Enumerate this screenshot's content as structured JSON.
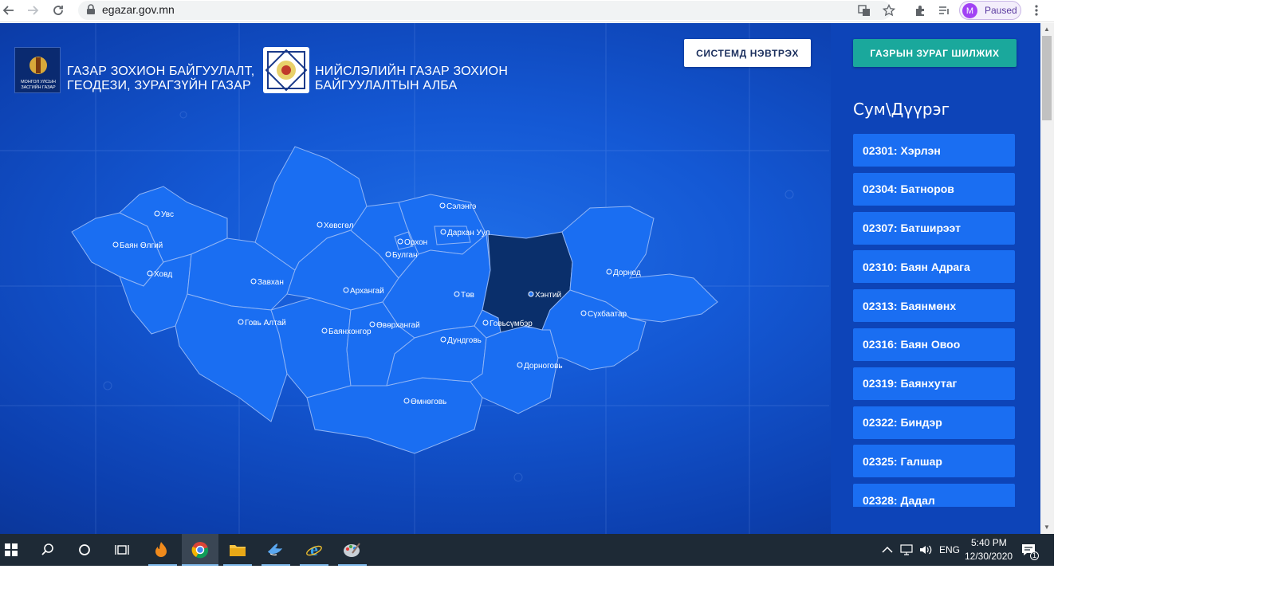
{
  "browser": {
    "url": "egazar.gov.mn",
    "profile_initial": "M",
    "profile_status": "Paused"
  },
  "header": {
    "gov_title_line1": "ГАЗАР ЗОХИОН БАЙГУУЛАЛТ,",
    "gov_title_line2": "ГЕОДЕЗИ, ЗУРАГЗҮЙН ГАЗАР",
    "gov_logo_text": "МОНГОЛ УЛСЫН ЗАСГИЙН ГАЗАР",
    "city_title_line1": "НИЙСЛЭЛИЙН ГАЗАР ЗОХИОН",
    "city_title_line2": "БАЙГУУЛАЛТЫН АЛБА",
    "login_label": "СИСТЕМД НЭВТРЭХ"
  },
  "panel": {
    "map_switch_label": "ГАЗРЫН ЗУРАГ ШИЛЖИХ",
    "title": "Сум\\Дүүрэг",
    "districts": [
      "02301: Хэрлэн",
      "02304: Батноров",
      "02307: Батширээт",
      "02310: Баян Адрага",
      "02313: Баянмөнх",
      "02316: Баян Овоо",
      "02319: Баянхутаг",
      "02322: Биндэр",
      "02325: Галшар",
      "02328: Дадал"
    ]
  },
  "map": {
    "selected_province": "Хэнтий",
    "labels": {
      "uvs": "Увс",
      "bayan_olgii": "Баян Өлгий",
      "khovd": "Ховд",
      "govi_altai": "Говь Алтай",
      "zavkhan": "Завхан",
      "khovsgol": "Хөвсгөл",
      "arkhangai": "Архангай",
      "bayankhongor": "Баянхонгор",
      "ovorkhangai": "Өвөрхангай",
      "umnogovi": "Өмнөговь",
      "bulgan": "Булган",
      "orkhon": "Орхон",
      "selenge": "Сэлэнгэ",
      "darkhan_uul": "Дархан Уул",
      "tov": "Төв",
      "dundgovi": "Дундговь",
      "govisumber": "Говьсүмбэр",
      "dornogovi": "Дорноговь",
      "khentii": "Хэнтий",
      "dornod": "Дорнод",
      "sukhbaatar": "Сүхбаатар"
    }
  },
  "taskbar": {
    "lang": "ENG",
    "time": "5:40 PM",
    "date": "12/30/2020",
    "notif_count": "1"
  }
}
